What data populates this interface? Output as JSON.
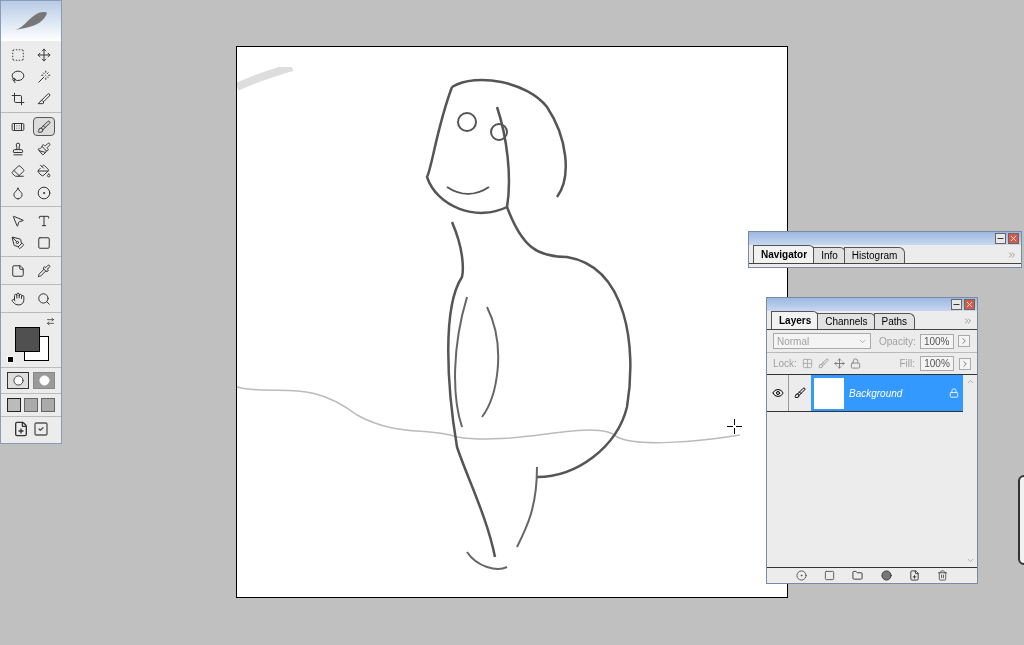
{
  "toolbox": {
    "tools": [
      {
        "selected": false
      },
      {
        "selected": false
      },
      {
        "selected": false
      },
      {
        "selected": false
      },
      {
        "selected": false
      },
      {
        "selected": false
      },
      {
        "selected": false
      },
      {
        "selected": true
      },
      {
        "selected": false
      },
      {
        "selected": false
      },
      {
        "selected": false
      },
      {
        "selected": false
      },
      {
        "selected": false
      },
      {
        "selected": false
      },
      {
        "selected": false
      },
      {
        "selected": false
      },
      {
        "selected": false
      },
      {
        "selected": false
      },
      {
        "selected": false
      },
      {
        "selected": false
      }
    ],
    "mask_modes": [
      {
        "selected": true
      },
      {
        "selected": false
      }
    ],
    "screen_modes": [
      {
        "selected": true
      },
      {
        "selected": false
      },
      {
        "selected": false
      }
    ]
  },
  "navigator_panel": {
    "tabs": [
      {
        "label": "Navigator",
        "selected": true
      },
      {
        "label": "Info",
        "selected": false
      },
      {
        "label": "Histogram",
        "selected": false
      }
    ]
  },
  "layers_panel": {
    "tabs": [
      {
        "label": "Layers",
        "selected": true
      },
      {
        "label": "Channels",
        "selected": false
      },
      {
        "label": "Paths",
        "selected": false
      }
    ],
    "controls_disabled": true,
    "blend_mode": "Normal",
    "opacity_label": "Opacity:",
    "opacity": "100%",
    "lock_label": "Lock:",
    "fill_label": "Fill:",
    "fill": "100%",
    "layers": [
      {
        "name": "Background",
        "selected": true,
        "visible": true,
        "locked": true
      }
    ]
  }
}
